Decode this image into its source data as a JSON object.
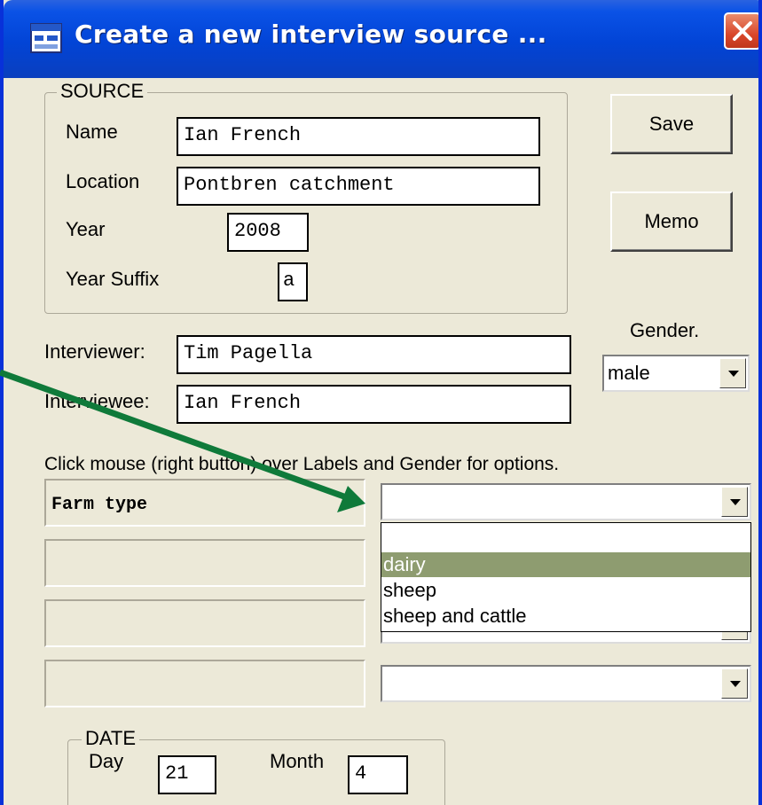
{
  "window": {
    "title": "Create a new interview source ..."
  },
  "source": {
    "legend": "SOURCE",
    "name_label": "Name",
    "name_value": "Ian French",
    "location_label": "Location",
    "location_value": "Pontbren catchment",
    "year_label": "Year",
    "year_value": "2008",
    "year_suffix_label": "Year Suffix",
    "year_suffix_value": "a"
  },
  "buttons": {
    "save": "Save",
    "memo": "Memo"
  },
  "gender": {
    "label": "Gender.",
    "selected": "male"
  },
  "interviewer": {
    "label": "Interviewer:",
    "value": "Tim Pagella"
  },
  "interviewee": {
    "label": "Interviewee:",
    "value": "Ian French"
  },
  "hint": "Click mouse (right button) over Labels and Gender for options.",
  "labels": {
    "rows": [
      {
        "label": "Farm type",
        "value": ""
      },
      {
        "label": "",
        "value": ""
      },
      {
        "label": "",
        "value": ""
      },
      {
        "label": "",
        "value": ""
      }
    ]
  },
  "dropdown": {
    "options": [
      "",
      "dairy",
      "sheep",
      "sheep and cattle"
    ],
    "highlighted": "dairy"
  },
  "date": {
    "legend": "DATE",
    "day_label": "Day",
    "day_value": "21",
    "month_label": "Month",
    "month_value": "4"
  },
  "colors": {
    "titlebar": "#0244d6",
    "annotation_arrow": "#0f7a3a",
    "highlight": "#8e9c70"
  }
}
